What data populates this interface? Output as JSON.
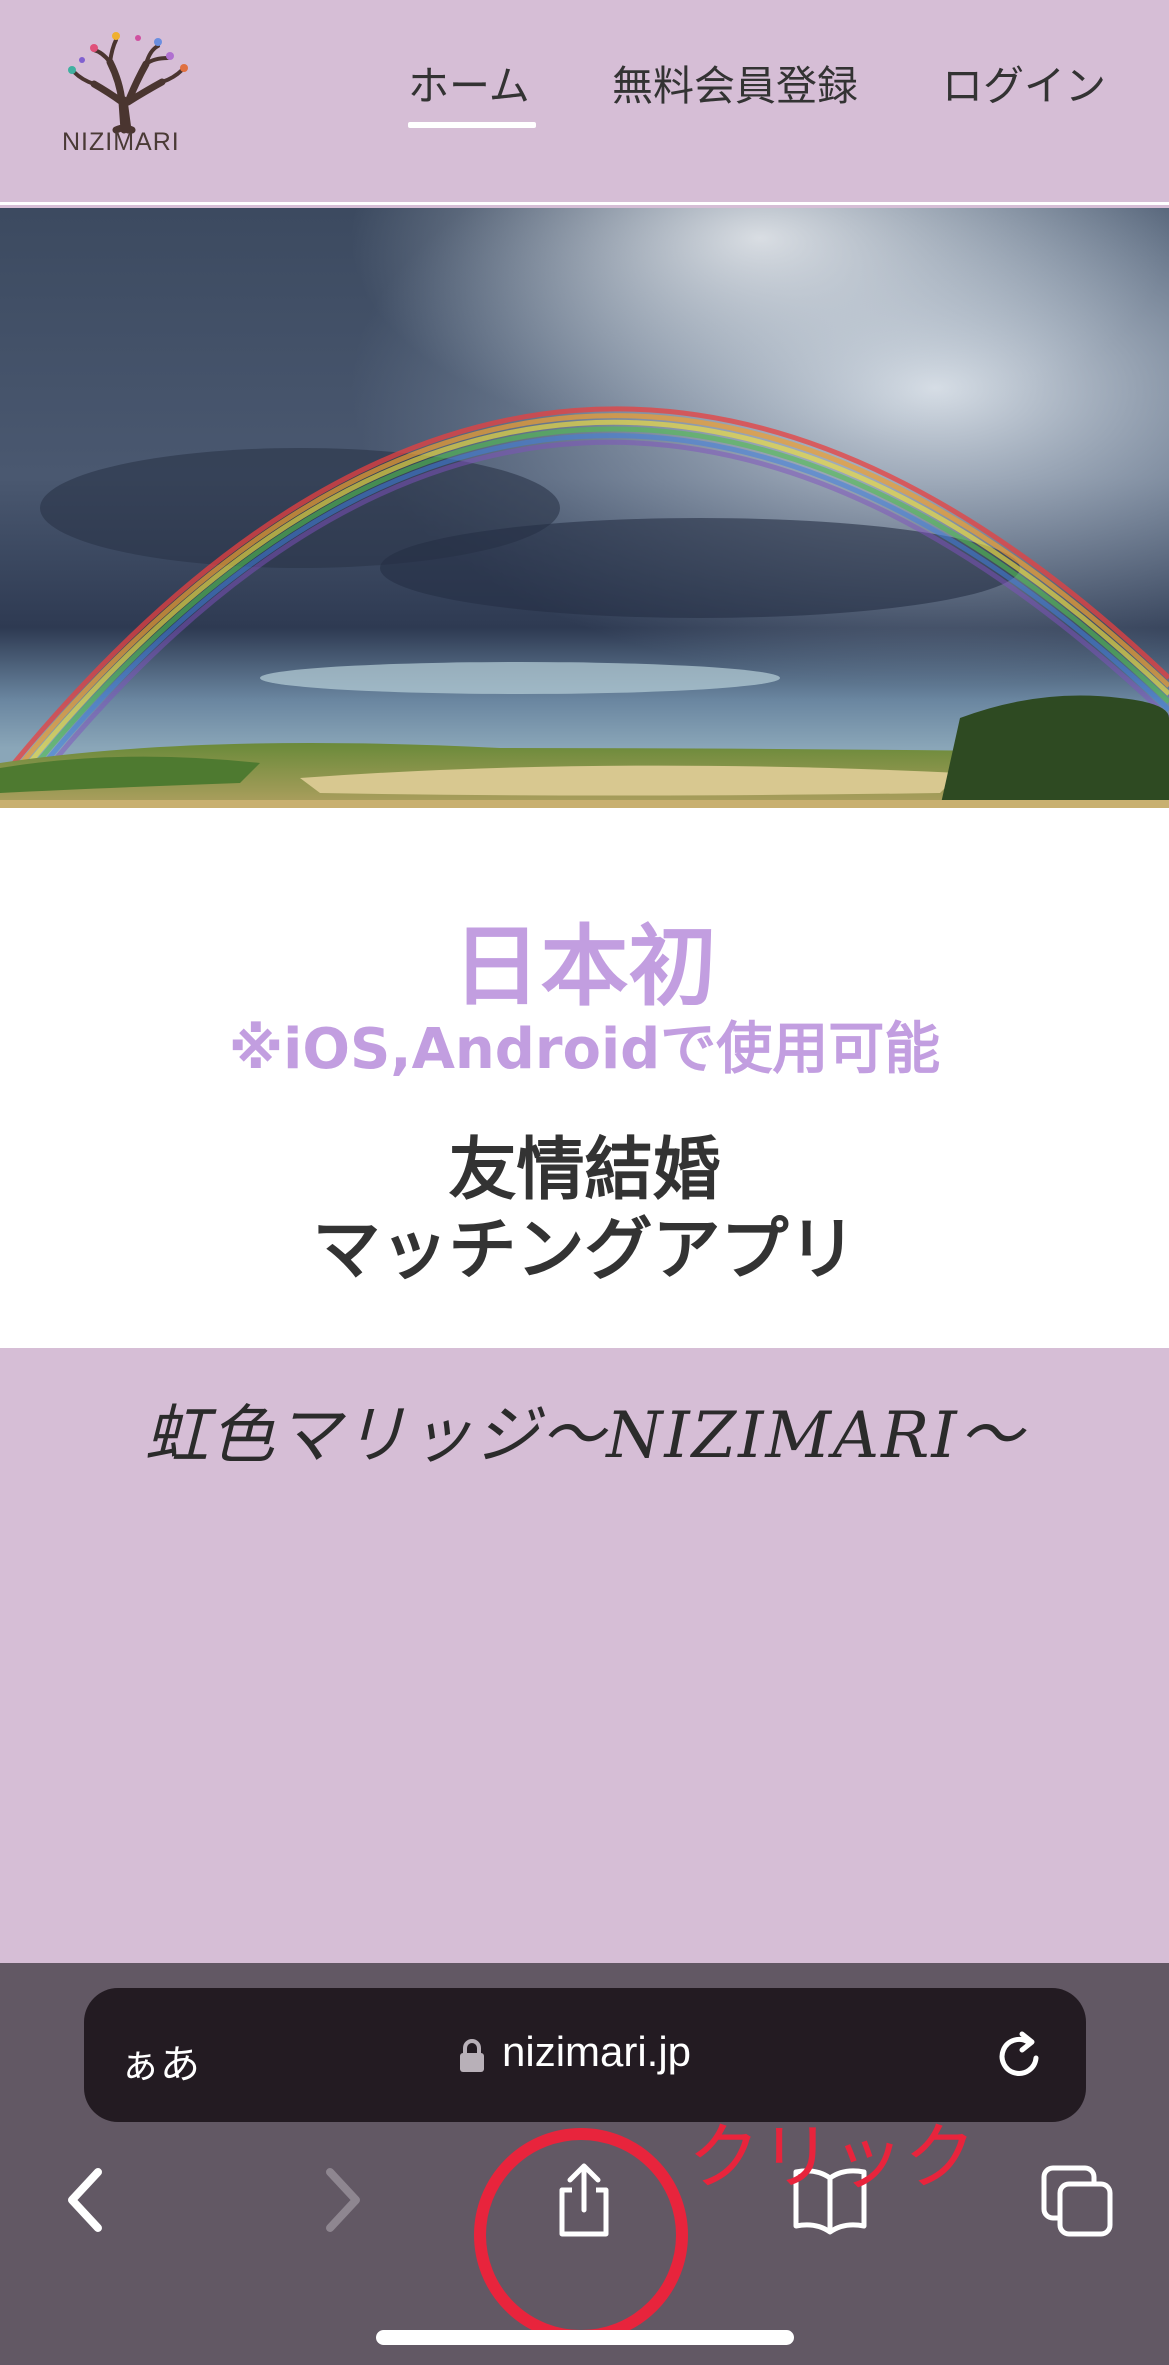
{
  "header": {
    "logo_text": "NIZIMARI",
    "nav": [
      {
        "label": "ホーム"
      },
      {
        "label": "無料会員登録"
      },
      {
        "label": "ログイン"
      }
    ]
  },
  "intro": {
    "title": "日本初",
    "note": "※iOS,Androidで使用可能",
    "tagline_line1": "友情結婚",
    "tagline_line2": "マッチングアプリ"
  },
  "brand": {
    "name": "虹色マリッジ～NIZIMARI～"
  },
  "browser": {
    "aa_label": "ぁあ",
    "url": "nizimari.jp",
    "icons": {
      "lock": "lock-icon",
      "reload": "reload-icon",
      "back": "chevron-left-icon",
      "forward": "chevron-right-icon",
      "share": "share-icon",
      "bookmarks": "book-icon",
      "tabs": "tabs-icon"
    }
  },
  "annotation": {
    "label": "クリック",
    "color": "#e8243c"
  },
  "colors": {
    "page_bg": "#d6bed6",
    "accent_purple": "#c29ee0",
    "toolbar_bg": "#625864",
    "urlbar_bg": "#231b22"
  }
}
